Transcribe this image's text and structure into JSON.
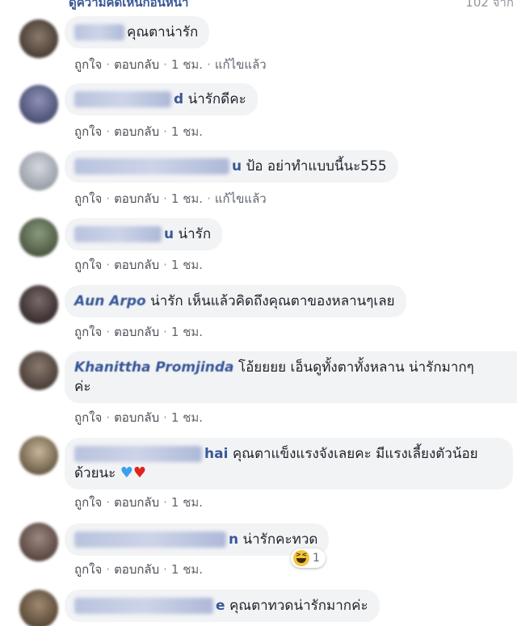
{
  "header": {
    "prev_label": "ดูความคิดเห็นก่อนหน้า",
    "count": "102 จาก"
  },
  "actions": {
    "like": "ถูกใจ",
    "reply": "ตอบกลับ",
    "sep": "·",
    "edited": "แก้ไขแล้ว"
  },
  "comments": [
    {
      "name_partial": "",
      "text": "คุณตาน่ารัก",
      "time": "1 ชม.",
      "edited": true
    },
    {
      "name_partial": "d",
      "text": "น่ารักดีคะ",
      "time": "1 ชม.",
      "edited": false
    },
    {
      "name_partial": "u",
      "text": "ป้อ อย่าทำแบบนี้นะ555",
      "time": "1 ชม.",
      "edited": true
    },
    {
      "name_partial": "u",
      "text": "น่ารัก",
      "time": "1 ชม.",
      "edited": false
    },
    {
      "name_partial": "Aun Arpo",
      "text": "น่ารัก เห็นแล้วคิดถึงคุณตาของหลานๆเลย",
      "time": "1 ชม.",
      "edited": false
    },
    {
      "name_partial": "Khanittha Promjinda",
      "text": "โอ้ยยยย เอ็นดูทั้งตาทั้งหลาน น่ารักมากๆ",
      "text2": "ค่ะ",
      "time": "1 ชม.",
      "edited": false
    },
    {
      "name_partial": "hai",
      "text": "คุณตาแข็งแรงจังเลยคะ มีแรงเลี้ยงตัวน้อย",
      "text2": "ด้วยนะ",
      "time": "1 ชม.",
      "edited": false
    },
    {
      "name_partial": "n",
      "text": "น่ารักคะทวด",
      "time": "1 ชม.",
      "edited": false,
      "reaction": {
        "icon": "haha-icon",
        "count": "1"
      }
    },
    {
      "name_partial": "e",
      "text": "คุณตาทวดน่ารักมากค่ะ"
    }
  ],
  "colors": {
    "bubble": "#f2f3f5",
    "name": "#385898",
    "action": "#606770"
  }
}
